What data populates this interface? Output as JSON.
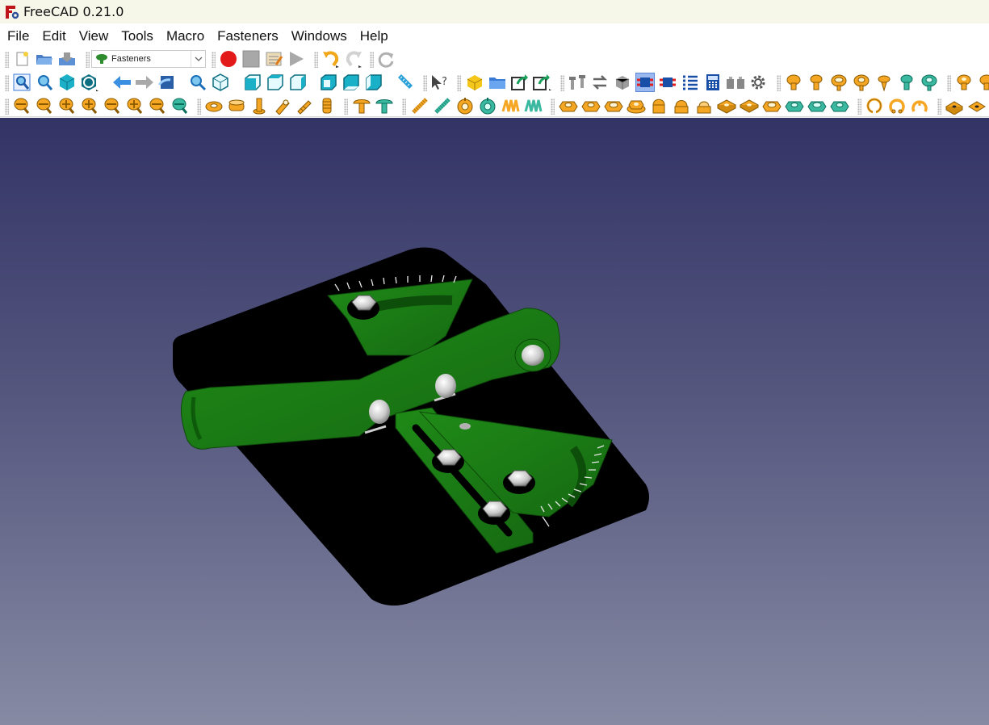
{
  "app": {
    "title": "FreeCAD 0.21.0"
  },
  "menu": [
    "File",
    "Edit",
    "View",
    "Tools",
    "Macro",
    "Fasteners",
    "Windows",
    "Help"
  ],
  "workbench_selector": {
    "value": "Fasteners"
  },
  "colors": {
    "viewport_top": "#333466",
    "viewport_bottom": "#878aa3",
    "part_green": "#1b7a16",
    "base_black": "#000000",
    "fastener_orange": "#f5a623"
  }
}
